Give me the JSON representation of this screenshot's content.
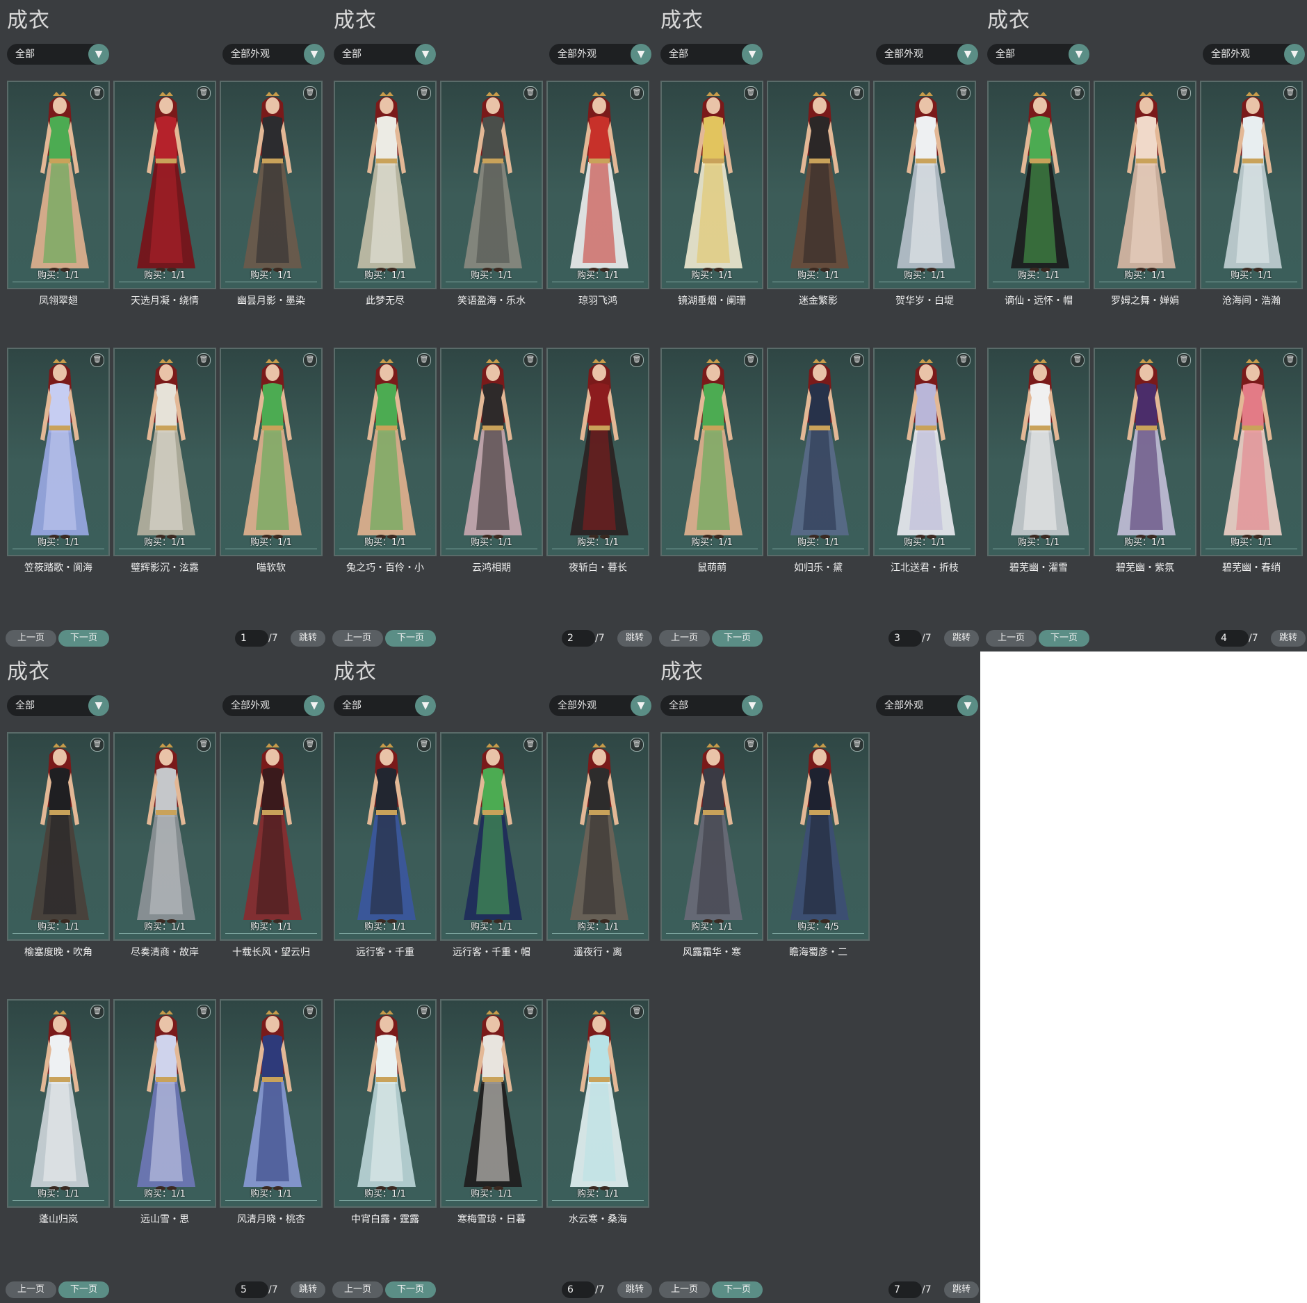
{
  "common": {
    "title": "成衣",
    "filter_left": "全部",
    "filter_right": "全部外观",
    "prev_label": "上一页",
    "next_label": "下一页",
    "jump_label": "跳转",
    "total_pages": "/7",
    "dropdown_icon": "chevron-down-icon",
    "trash_icon": "trash-icon"
  },
  "panels": [
    {
      "page": "1",
      "items": [
        {
          "name": "凤翎翠翅",
          "buy": "购买：1/1",
          "colors": [
            "#4cab52",
            "#e3b28f"
          ]
        },
        {
          "name": "天选月凝・绕情",
          "buy": "购买：1/1",
          "colors": [
            "#b5222b",
            "#7a1016"
          ]
        },
        {
          "name": "幽昙月影・墨染",
          "buy": "购买：1/1",
          "colors": [
            "#2c2c2f",
            "#6d5a4a"
          ]
        },
        {
          "name": "笠筱踏歌・阆海",
          "buy": "购买：1/1",
          "colors": [
            "#c6cdf2",
            "#9aa8e4"
          ]
        },
        {
          "name": "璧辉影沉・泫露",
          "buy": "购买：1/1",
          "colors": [
            "#e6e2d8",
            "#b7b1a0"
          ]
        },
        {
          "name": "喵软软",
          "buy": "购买：1/1",
          "colors": [
            "#4cab52",
            "#e3b28f"
          ]
        }
      ]
    },
    {
      "page": "2",
      "items": [
        {
          "name": "此梦无尽",
          "buy": "购买：1/1",
          "colors": [
            "#ecebe4",
            "#c5c0a8"
          ]
        },
        {
          "name": "笑语盈海・乐水",
          "buy": "购买：1/1",
          "colors": [
            "#4a4e4a",
            "#8b8a80"
          ]
        },
        {
          "name": "琼羽飞鸿",
          "buy": "购买：1/1",
          "colors": [
            "#c7312a",
            "#eeeeee"
          ]
        },
        {
          "name": "兔之巧・百伶・小",
          "buy": "购买：1/1",
          "colors": [
            "#4cab52",
            "#e3b28f"
          ]
        },
        {
          "name": "云鸿相期",
          "buy": "购买：1/1",
          "colors": [
            "#2e2a2a",
            "#c9a8b0"
          ]
        },
        {
          "name": "夜斩白・暮长",
          "buy": "购买：1/1",
          "colors": [
            "#8c1c1e",
            "#2a2020"
          ]
        }
      ]
    },
    {
      "page": "3",
      "items": [
        {
          "name": "镜湖垂烟・阑珊",
          "buy": "购买：1/1",
          "colors": [
            "#e2c45e",
            "#f1ead0"
          ]
        },
        {
          "name": "迷金繁影",
          "buy": "购买：1/1",
          "colors": [
            "#2b2727",
            "#6b4b3a"
          ]
        },
        {
          "name": "贺华岁・白堤",
          "buy": "购买：1/1",
          "colors": [
            "#eef0f2",
            "#b9c2cc"
          ]
        },
        {
          "name": "鼠萌萌",
          "buy": "购买：1/1",
          "colors": [
            "#4cab52",
            "#e3b28f"
          ]
        },
        {
          "name": "如归乐・黛",
          "buy": "购买：1/1",
          "colors": [
            "#27324a",
            "#5a6a8a"
          ]
        },
        {
          "name": "江北送君・折枝",
          "buy": "购买：1/1",
          "colors": [
            "#b9b6d8",
            "#ececf2"
          ]
        }
      ]
    },
    {
      "page": "4",
      "items": [
        {
          "name": "谪仙・远怀・帽",
          "buy": "购买：1/1",
          "colors": [
            "#4cab52",
            "#1b1b1b"
          ]
        },
        {
          "name": "罗姆之舞・婵娟",
          "buy": "购买：1/1",
          "colors": [
            "#f0d9c9",
            "#d9b8a4"
          ]
        },
        {
          "name": "沧海间・浩瀚",
          "buy": "购买：1/1",
          "colors": [
            "#e8eef0",
            "#c3d0d4"
          ]
        },
        {
          "name": "碧芜幽・濯雪",
          "buy": "购买：1/1",
          "colors": [
            "#f0f0f0",
            "#c9cccf"
          ]
        },
        {
          "name": "碧芜幽・紫氛",
          "buy": "购买：1/1",
          "colors": [
            "#4b2d6a",
            "#c3bfd8"
          ]
        },
        {
          "name": "碧芜幽・春绡",
          "buy": "购买：1/1",
          "colors": [
            "#e37b86",
            "#f1d2c8"
          ]
        }
      ]
    },
    {
      "page": "5",
      "items": [
        {
          "name": "榆塞度晚・吹角",
          "buy": "购买：1/1",
          "colors": [
            "#1f1f22",
            "#4a3f38"
          ]
        },
        {
          "name": "尽奏清商・故岸",
          "buy": "购买：1/1",
          "colors": [
            "#c5c7ca",
            "#8f9398"
          ]
        },
        {
          "name": "十载长风・望云归",
          "buy": "购买：1/1",
          "colors": [
            "#3a1a1c",
            "#8a2a2e"
          ]
        },
        {
          "name": "蓬山归岚",
          "buy": "购买：1/1",
          "colors": [
            "#eef1f3",
            "#cfd6dc"
          ]
        },
        {
          "name": "远山雪・思",
          "buy": "购买：1/1",
          "colors": [
            "#cfd3ec",
            "#6f78b8"
          ]
        },
        {
          "name": "风清月晓・桃杏",
          "buy": "购买：1/1",
          "colors": [
            "#2e3a7a",
            "#8a9ad6"
          ]
        }
      ]
    },
    {
      "page": "6",
      "items": [
        {
          "name": "远行客・千重",
          "buy": "购买：1/1",
          "colors": [
            "#222630",
            "#3b56a0"
          ]
        },
        {
          "name": "远行客・千重・帽",
          "buy": "购买：1/1",
          "colors": [
            "#4cab52",
            "#1e2a5a"
          ]
        },
        {
          "name": "遥夜行・离",
          "buy": "购买：1/1",
          "colors": [
            "#2d2c2c",
            "#6e6256"
          ]
        },
        {
          "name": "中宵白露・霆露",
          "buy": "购买：1/1",
          "colors": [
            "#eaf2f2",
            "#bcd6d8"
          ]
        },
        {
          "name": "寒梅雪琼・日暮",
          "buy": "购买：1/1",
          "colors": [
            "#e8e4de",
            "#1f1c1c"
          ]
        },
        {
          "name": "水云寒・桑海",
          "buy": "购买：1/1",
          "colors": [
            "#b8e2e6",
            "#e4f3f4"
          ]
        }
      ]
    },
    {
      "page": "7",
      "items": [
        {
          "name": "风露霜华・寒",
          "buy": "购买：1/1",
          "colors": [
            "#3a3a44",
            "#6a6a78"
          ]
        },
        {
          "name": "瞻海蜀彦・二",
          "buy": "购买：4/5",
          "colors": [
            "#1e2230",
            "#3d4e74"
          ]
        }
      ]
    }
  ]
}
